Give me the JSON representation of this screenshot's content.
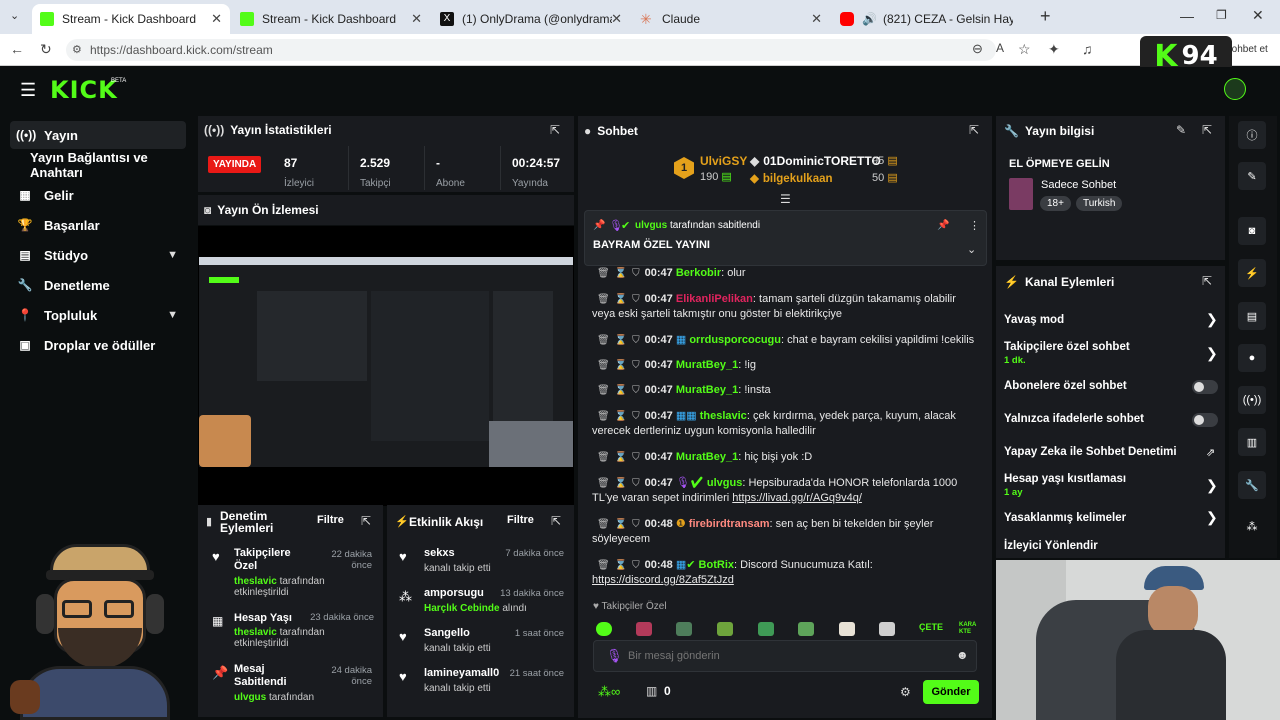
{
  "browser": {
    "tabs": [
      {
        "title": "Stream - Kick Dashboard",
        "active": true,
        "color": "#53fc18"
      },
      {
        "title": "Stream - Kick Dashboard",
        "active": false,
        "color": "#53fc18"
      },
      {
        "title": "(1) OnlyDrama (@onlydramaX) / X",
        "active": false,
        "color": "#111111"
      },
      {
        "title": "Claude",
        "active": false,
        "color": "#d97757"
      },
      {
        "title": "(821) CEZA - Gelsin Hayat Bild",
        "active": false,
        "color": "#ff0000"
      }
    ],
    "url": "https://dashboard.kick.com/stream",
    "chat_label": "Sohbet et"
  },
  "header": {
    "logo": "KICK",
    "beta": "BETA"
  },
  "overlay": {
    "logo_text": "94",
    "logo_letter": "K"
  },
  "sidebar": {
    "items": [
      {
        "label": "Yayın",
        "icon": "broadcast-icon",
        "active": true
      },
      {
        "label": "Yayın Bağlantısı ve Anahtarı"
      },
      {
        "label": "Gelir",
        "icon": "chart-icon"
      },
      {
        "label": "Başarılar",
        "icon": "trophy-icon"
      },
      {
        "label": "Stüdyo",
        "icon": "studio-icon",
        "chevron": true
      },
      {
        "label": "Denetleme",
        "icon": "wrench-icon"
      },
      {
        "label": "Topluluk",
        "icon": "community-icon",
        "chevron": true
      },
      {
        "label": "Droplar ve ödüller",
        "icon": "gift-icon"
      }
    ]
  },
  "stats": {
    "title": "Yayın İstatistikleri",
    "live_badge": "YAYINDA",
    "items": [
      {
        "value": "87",
        "label": "İzleyici"
      },
      {
        "value": "2.529",
        "label": "Takipçi"
      },
      {
        "value": "-",
        "label": "Abone"
      },
      {
        "value": "00:24:57",
        "label": "Yayında"
      }
    ]
  },
  "preview": {
    "title": "Yayın Ön İzlemesi"
  },
  "moderation": {
    "title": "Denetim Eylemleri",
    "filter": "Filtre",
    "items": [
      {
        "title": "Takipçilere Özel",
        "user": "theslavic",
        "desc": "tarafından etkinleştirildi",
        "time": "22 dakika önce"
      },
      {
        "title": "Hesap Yaşı",
        "user": "theslavic",
        "desc": "tarafından etkinleştirildi",
        "time": "23 dakika önce"
      },
      {
        "title": "Mesaj Sabitlendi",
        "user": "ulvgus",
        "desc": "tarafından",
        "time": "24 dakika önce"
      }
    ]
  },
  "activity": {
    "title": "Etkinlik Akışı",
    "filter": "Filtre",
    "items": [
      {
        "user": "sekxs",
        "desc": "kanalı takip etti",
        "time": "7 dakika önce"
      },
      {
        "user": "amporsugu",
        "highlight": "Harçlık Cebinde",
        "desc": "alındı",
        "time": "13 dakika önce"
      },
      {
        "user": "Sangello",
        "desc": "kanalı takip etti",
        "time": "1 saat önce"
      },
      {
        "user": "lamineyamall0",
        "desc": "kanalı takip etti",
        "time": "21 saat önce"
      }
    ]
  },
  "chat": {
    "title": "Sohbet",
    "leaderboard": [
      {
        "rank": "1",
        "user": "UlviGSY",
        "score": "190"
      },
      {
        "user": "01DominicTORETTO",
        "score": "95"
      },
      {
        "user": "bilgekulkaan",
        "score": "50"
      }
    ],
    "pinned": {
      "by_user": "ulvgus",
      "by_text": "tarafından sabitlendi",
      "message": "BAYRAM ÖZEL YAYINI"
    },
    "messages": [
      {
        "time": "00:47",
        "user": "Berkobir",
        "color": "#53fc18",
        "text": "olur"
      },
      {
        "time": "00:47",
        "user": "ElikanliPelikan",
        "color": "#e0245e",
        "text": "tamam şarteli düzgün takamamış olabilir veya eski şarteli takmıştır onu göster bi elektirikçiye"
      },
      {
        "time": "00:47",
        "user": "orrdusporcocugu",
        "color": "#53fc18",
        "text": "chat e bayram cekilisi yapildimi !cekilis"
      },
      {
        "time": "00:47",
        "user": "MuratBey_1",
        "color": "#53fc18",
        "text": "!ig"
      },
      {
        "time": "00:47",
        "user": "MuratBey_1",
        "color": "#53fc18",
        "text": "!insta"
      },
      {
        "time": "00:47",
        "user": "theslavic",
        "color": "#53fc18",
        "text": "çek kırdırma, yedek parça, kuyum, alacak verecek dertleriniz uygun komisyonla halledilir"
      },
      {
        "time": "00:47",
        "user": "MuratBey_1",
        "color": "#53fc18",
        "text": "hiç bişi yok :D"
      },
      {
        "time": "00:47",
        "user": "ulvgus",
        "color": "#53fc18",
        "text": "Hepsiburada'da HONOR telefonlarda 1000 TL'ye varan sepet indirimleri",
        "link": "https://livad.gg/r/AGq9v4q/"
      },
      {
        "time": "00:48",
        "user": "firebirdtransam",
        "color": "#ff8a80",
        "text": "sen aç ben bi tekelden bir şeyler söyleyecem"
      },
      {
        "time": "00:48",
        "user": "BotRix",
        "color": "#53fc18",
        "text": "Discord Sunucumuza Katıl:",
        "link": "https://discord.gg/8Zaf5ZtJzd"
      }
    ],
    "followers_only": "Takipçiler Özel",
    "input_placeholder": "Bir mesaj gönderin",
    "points": "0",
    "send": "Gönder"
  },
  "stream_info": {
    "title": "Yayın bilgisi",
    "stream_title": "EL ÖPMEYE GELİN",
    "category": "Sadece Sohbet",
    "tags": [
      "18+",
      "Turkish"
    ]
  },
  "channel_actions": {
    "title": "Kanal Eylemleri",
    "rows": [
      {
        "label": "Yavaş mod",
        "type": "arrow"
      },
      {
        "label": "Takipçilere özel sohbet",
        "sub": "1 dk.",
        "type": "arrow"
      },
      {
        "label": "Abonelere özel sohbet",
        "type": "toggle"
      },
      {
        "label": "Yalnızca ifadelerle sohbet",
        "type": "toggle"
      },
      {
        "label": "Yapay Zeka ile Sohbet Denetimi",
        "type": "external"
      },
      {
        "label": "Hesap yaşı kısıtlaması",
        "sub": "1 ay",
        "type": "arrow"
      },
      {
        "label": "Yasaklanmış kelimeler",
        "type": "arrow"
      },
      {
        "label": "İzleyici Yönlendir",
        "type": "none"
      }
    ]
  },
  "colors": {
    "accent": "#53fc18",
    "live": "#e91916",
    "panel": "#191b1f",
    "bg": "#0b0e0f"
  }
}
